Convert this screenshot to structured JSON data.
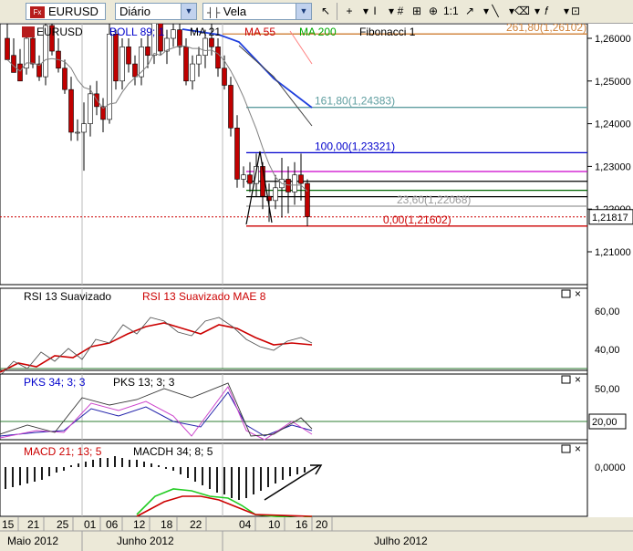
{
  "toolbar": {
    "symbol": "EURUSD",
    "period": "Diário",
    "chart_style": "Vela",
    "tools": [
      "+",
      "▾",
      "I",
      "▾",
      "#",
      "⊞",
      "⊕",
      "1:1",
      "↗",
      "▾",
      "╲",
      "▾",
      "⌫",
      "▾",
      "𝑓",
      "▾",
      "⊡"
    ]
  },
  "legend": {
    "symbol": "EURUSD",
    "boll": "BOLL 89; 1",
    "ma21": "MA 21",
    "ma55": "MA 55",
    "ma200": "MA 200",
    "fib": "Fibonacci 1"
  },
  "fib_levels": [
    {
      "label": "261,80(1,26102)",
      "value": 1.26102,
      "color": "#d0833b"
    },
    {
      "label": "161,80(1,24383)",
      "value": 1.24383,
      "color": "#5f9ea0"
    },
    {
      "label": "100,00(1,23321)",
      "value": 1.23321,
      "color": "#0000cc"
    },
    {
      "label": "",
      "value": 1.2288,
      "color": "#cc00cc"
    },
    {
      "label": "",
      "value": 1.2265,
      "color": "#000000"
    },
    {
      "label": "",
      "value": 1.2244,
      "color": "#006400"
    },
    {
      "label": "",
      "value": 1.2229,
      "color": "#000000"
    },
    {
      "label": "23,60(1,22068)",
      "value": 1.22068,
      "color": "#999999"
    },
    {
      "label": "0,00(1,21602)",
      "value": 1.21602,
      "color": "#cc0000"
    }
  ],
  "current_price": "1,21817",
  "rsi": {
    "title1": "RSI 13 Suavizado",
    "title2": "RSI 13 Suavizado MAE 8",
    "ticks": [
      "60,00",
      "40,00"
    ]
  },
  "pks": {
    "title1": "PKS 34; 3; 3",
    "title2": "PKS 13; 3; 3",
    "ticks": [
      "50,00",
      "20,00"
    ]
  },
  "macd": {
    "title1": "MACD 21; 13; 5",
    "title2": "MACDH 34; 8; 5",
    "ticks": [
      "0,0000"
    ]
  },
  "dates": {
    "days": [
      "15",
      "21",
      "25",
      "01",
      "06",
      "12",
      "18",
      "22",
      "04",
      "10",
      "16",
      "20"
    ],
    "months": [
      "Maio 2012",
      "Junho 2012",
      "Julho 2012"
    ]
  },
  "chart_data": {
    "type": "candlestick",
    "ylim": [
      1.2,
      1.265
    ],
    "y_ticks": [
      1.26,
      1.25,
      1.24,
      1.23,
      1.22,
      1.21
    ],
    "y_tick_labels": [
      "1,26000",
      "1,25000",
      "1,24000",
      "1,23000",
      "1,22000",
      "1,21000"
    ],
    "candles": [
      [
        1.26,
        1.264,
        1.258,
        1.255
      ],
      [
        1.256,
        1.26,
        1.254,
        1.252
      ],
      [
        1.254,
        1.2575,
        1.252,
        1.25
      ],
      [
        1.253,
        1.262,
        1.2515,
        1.26
      ],
      [
        1.26,
        1.261,
        1.253,
        1.254
      ],
      [
        1.254,
        1.256,
        1.25,
        1.251
      ],
      [
        1.251,
        1.265,
        1.249,
        1.263
      ],
      [
        1.263,
        1.264,
        1.256,
        1.257
      ],
      [
        1.257,
        1.26,
        1.252,
        1.253
      ],
      [
        1.253,
        1.255,
        1.247,
        1.248
      ],
      [
        1.248,
        1.251,
        1.236,
        1.238
      ],
      [
        1.238,
        1.241,
        1.236,
        1.238
      ],
      [
        1.238,
        1.245,
        1.229,
        1.24
      ],
      [
        1.24,
        1.249,
        1.237,
        1.247
      ],
      [
        1.247,
        1.25,
        1.242,
        1.244
      ],
      [
        1.244,
        1.246,
        1.238,
        1.241
      ],
      [
        1.241,
        1.265,
        1.24,
        1.261
      ],
      [
        1.261,
        1.262,
        1.248,
        1.25
      ],
      [
        1.25,
        1.26,
        1.248,
        1.258
      ],
      [
        1.258,
        1.26,
        1.252,
        1.254
      ],
      [
        1.254,
        1.256,
        1.249,
        1.251
      ],
      [
        1.251,
        1.26,
        1.249,
        1.258
      ],
      [
        1.258,
        1.261,
        1.253,
        1.256
      ],
      [
        1.256,
        1.265,
        1.254,
        1.264
      ],
      [
        1.264,
        1.265,
        1.256,
        1.257
      ],
      [
        1.257,
        1.262,
        1.254,
        1.26
      ],
      [
        1.26,
        1.265,
        1.258,
        1.262
      ],
      [
        1.262,
        1.264,
        1.256,
        1.258
      ],
      [
        1.258,
        1.26,
        1.249,
        1.25
      ],
      [
        1.25,
        1.256,
        1.248,
        1.254
      ],
      [
        1.254,
        1.258,
        1.251,
        1.256
      ],
      [
        1.256,
        1.262,
        1.253,
        1.26
      ],
      [
        1.26,
        1.265,
        1.256,
        1.258
      ],
      [
        1.258,
        1.26,
        1.251,
        1.253
      ],
      [
        1.253,
        1.256,
        1.248,
        1.249
      ],
      [
        1.249,
        1.251,
        1.237,
        1.239
      ],
      [
        1.239,
        1.242,
        1.225,
        1.227
      ],
      [
        1.227,
        1.23,
        1.225,
        1.228
      ],
      [
        1.228,
        1.231,
        1.224,
        1.226
      ],
      [
        1.226,
        1.233,
        1.223,
        1.23
      ],
      [
        1.23,
        1.231,
        1.22,
        1.223
      ],
      [
        1.223,
        1.226,
        1.217,
        1.222
      ],
      [
        1.222,
        1.228,
        1.22,
        1.225
      ],
      [
        1.225,
        1.232,
        1.218,
        1.227
      ],
      [
        1.227,
        1.23,
        1.219,
        1.224
      ],
      [
        1.224,
        1.231,
        1.221,
        1.228
      ],
      [
        1.228,
        1.233,
        1.222,
        1.226
      ],
      [
        1.226,
        1.227,
        1.216,
        1.2182
      ]
    ]
  }
}
